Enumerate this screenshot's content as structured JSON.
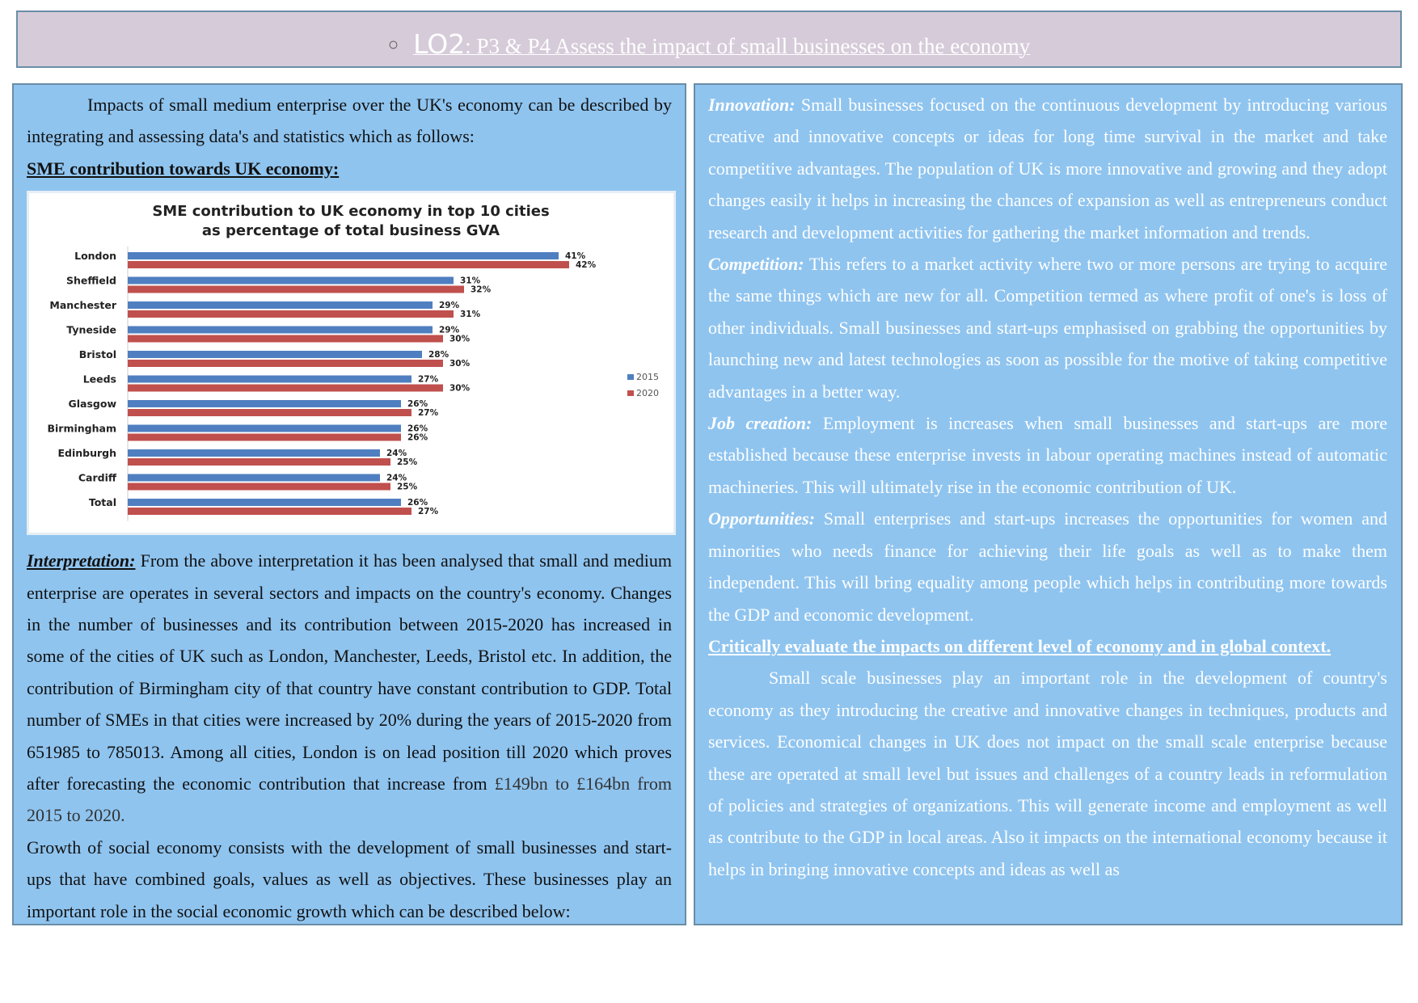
{
  "header": {
    "lo": "LO2",
    "title": ": P3 & P4 Assess the impact of small businesses on the economy"
  },
  "left": {
    "intro": "Impacts of small medium enterprise over the UK's economy can be described by integrating and assessing data's and statistics which as follows:",
    "heading": "SME contribution towards UK economy:",
    "interp_label": "Interpretation:",
    "interp_text": " From the above interpretation it has been analysed that small and medium enterprise are operates in several sectors and impacts on the country's economy. Changes in the number of businesses and its contribution between 2015-2020 has increased in some of the cities of UK such as London, Manchester, Leeds, Bristol etc. In addition, the contribution of Birmingham city of that country have constant contribution to GDP. Total number of SMEs in that cities were increased by 20% during the years of 2015-2020 from 651985 to 785013. Among all cities, London is on lead position till 2020 which proves after forecasting the economic contribution that increase from ",
    "interp_tail": "£149bn to £164bn from 2015 to 2020.",
    "growth": "Growth of social economy consists with the development of small businesses and start-ups that have combined goals, values as well as objectives. These businesses play an important role in the social economic growth which can be described below:"
  },
  "right": {
    "items": [
      {
        "label": "Innovation:",
        "text": " Small businesses focused on the continuous development by introducing various creative and innovative concepts or ideas for long time survival in the market and take competitive advantages. The population of UK is more innovative and growing and they adopt changes easily it helps in increasing the chances of expansion as well as entrepreneurs conduct research and development activities for gathering the market information and trends."
      },
      {
        "label": "Competition:",
        "text": " This refers to a market activity where two or more persons are trying to acquire the same things which are new for all. Competition termed as where profit of one's is loss of other individuals. Small businesses and start-ups emphasised on grabbing the opportunities by launching new and latest technologies as soon as possible for the motive of taking competitive advantages in a better way."
      },
      {
        "label": "Job creation:",
        "text": " Employment is increases when small businesses and start-ups are more established because these enterprise invests in labour operating machines instead of automatic machineries. This will ultimately rise in the economic contribution of UK."
      },
      {
        "label": "Opportunities:",
        "text": " Small enterprises and start-ups increases the opportunities for women and minorities who needs finance for achieving their life goals as well as to make them independent. This will bring equality among people which helps in contributing more towards the GDP and economic development."
      }
    ],
    "heading": "Critically evaluate the impacts on different level of economy and in global context.",
    "para": "Small scale businesses play an important role in the development of country's economy as they introducing the creative and innovative changes in techniques, products and services. Economical changes in UK does not impact on the small scale enterprise because these are operated at small level but issues and challenges of a country leads in reformulation of policies and strategies of organizations. This will generate income and employment as well as contribute to the GDP in local areas. Also it impacts on the international economy because it helps in bringing innovative concepts and ideas as well as"
  },
  "chart_data": {
    "type": "bar",
    "orientation": "horizontal",
    "title": "SME contribution to UK economy in top 10 cities as percentage of total business GVA",
    "title_lines": [
      "SME contribution to UK economy in top 10 cities",
      "as percentage of total business GVA"
    ],
    "categories": [
      "London",
      "Sheffield",
      "Manchester",
      "Tyneside",
      "Bristol",
      "Leeds",
      "Glasgow",
      "Birmingham",
      "Edinburgh",
      "Cardiff",
      "Total"
    ],
    "series": [
      {
        "name": "2015",
        "color": "#4f7fc0",
        "values": [
          41,
          31,
          29,
          29,
          28,
          27,
          26,
          26,
          24,
          24,
          26
        ]
      },
      {
        "name": "2020",
        "color": "#c0504d",
        "values": [
          42,
          32,
          31,
          30,
          30,
          30,
          27,
          26,
          25,
          25,
          27
        ]
      }
    ],
    "value_suffix": "%",
    "legend": "right",
    "grid": false
  }
}
